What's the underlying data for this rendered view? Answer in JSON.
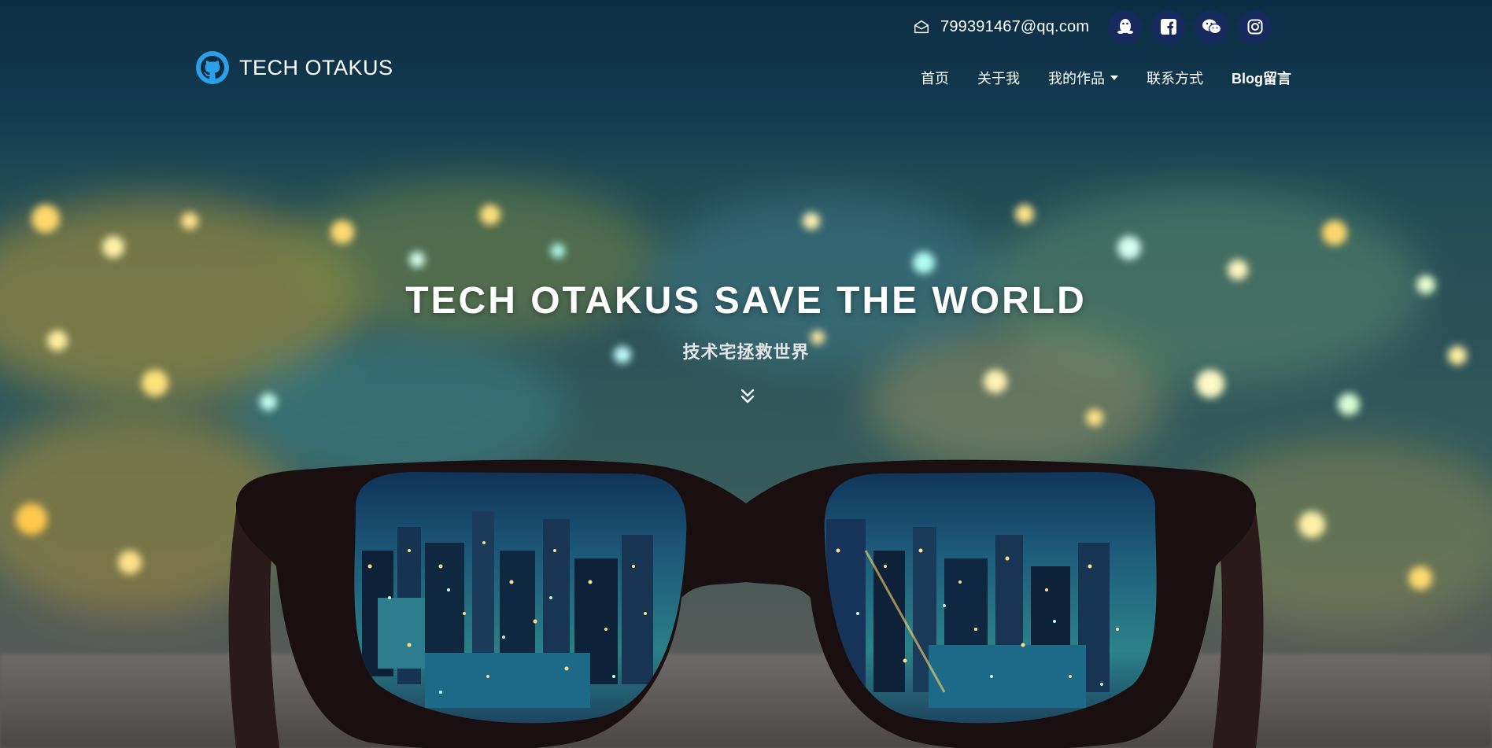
{
  "brand": {
    "name": "TECH OTAKUS",
    "logo_icon": "github-octocat-icon",
    "logo_color": "#2aa0e8"
  },
  "contact": {
    "email_icon": "envelope-open-icon",
    "email": "799391467@qq.com",
    "social": [
      {
        "name": "qq",
        "icon": "qq-penguin-icon"
      },
      {
        "name": "facebook",
        "icon": "facebook-icon"
      },
      {
        "name": "wechat",
        "icon": "wechat-icon"
      },
      {
        "name": "instagram",
        "icon": "instagram-icon"
      }
    ],
    "social_bg": "#172a5e"
  },
  "nav": {
    "items": [
      {
        "label": "首页"
      },
      {
        "label": "关于我"
      },
      {
        "label": "我的作品",
        "dropdown": true
      },
      {
        "label": "联系方式"
      },
      {
        "label": "Blog留言"
      }
    ]
  },
  "hero": {
    "title": "TECH OTAKUS SAVE THE WORLD",
    "subtitle": "技术宅拯救世界",
    "scroll_icon": "double-chevron-down-icon"
  },
  "colors": {
    "text": "#ffffff",
    "background_top": "#0c2e44",
    "glasses_frame": "#1a0f10"
  }
}
